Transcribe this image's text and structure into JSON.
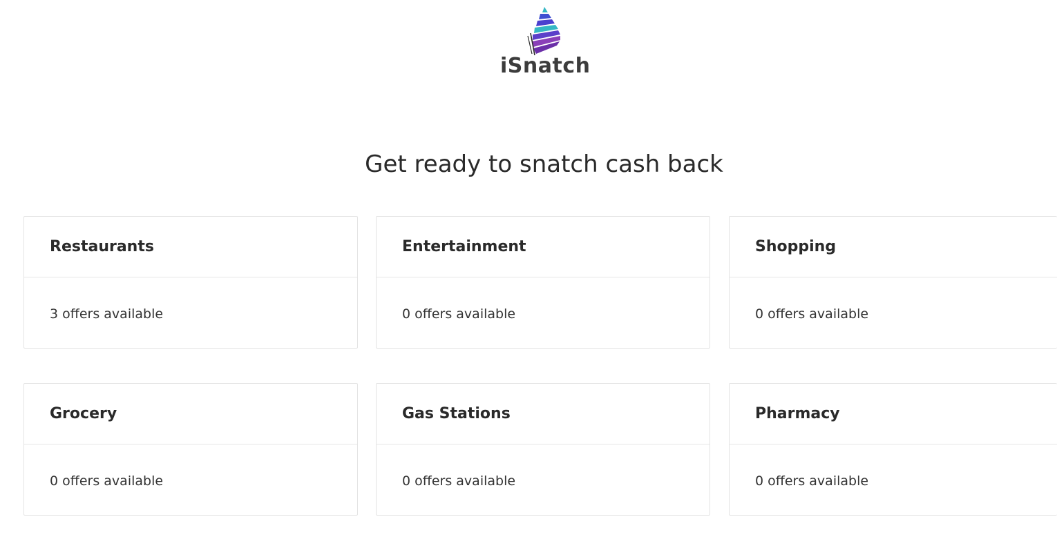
{
  "brand": {
    "name": "iSnatch",
    "colors": [
      "#6a3fc4",
      "#8a3fb8",
      "#3d4ed1",
      "#35b7c4",
      "#2a2a2a"
    ]
  },
  "headline": "Get ready to snatch cash back",
  "categories": [
    {
      "title": "Restaurants",
      "offers": "3 offers available"
    },
    {
      "title": "Entertainment",
      "offers": "0 offers available"
    },
    {
      "title": "Shopping",
      "offers": "0 offers available"
    },
    {
      "title": "Grocery",
      "offers": "0 offers available"
    },
    {
      "title": "Gas Stations",
      "offers": "0 offers available"
    },
    {
      "title": "Pharmacy",
      "offers": "0 offers available"
    }
  ]
}
